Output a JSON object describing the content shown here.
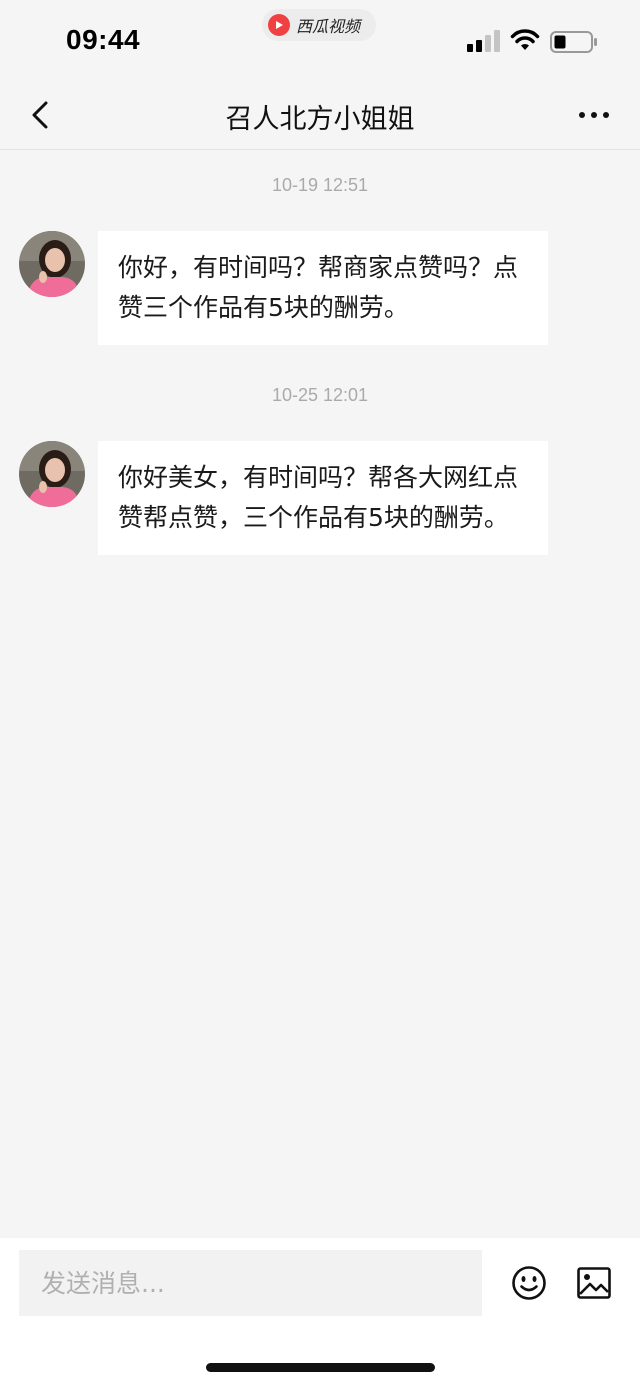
{
  "status_bar": {
    "time": "09:44",
    "app_name": "西瓜视频",
    "icons": [
      "cellular-signal-icon",
      "wifi-icon",
      "battery-icon"
    ]
  },
  "nav": {
    "title": "召人北方小姐姐",
    "back_icon": "chevron-left-icon",
    "more_icon": "more-dots-icon"
  },
  "messages": [
    {
      "timestamp": "10-19 12:51",
      "sender": "召人北方小姐姐",
      "text": "你好，有时间吗？帮商家点赞吗？点赞三个作品有5块的酬劳。"
    },
    {
      "timestamp": "10-25 12:01",
      "sender": "召人北方小姐姐",
      "text": "你好美女，有时间吗？帮各大网红点赞帮点赞，三个作品有5块的酬劳。"
    }
  ],
  "input": {
    "placeholder": "发送消息...",
    "value": ""
  },
  "colors": {
    "background": "#f5f5f5",
    "bubble": "#ffffff",
    "timestamp": "#aaaaaa",
    "app_logo": "#f04142"
  }
}
